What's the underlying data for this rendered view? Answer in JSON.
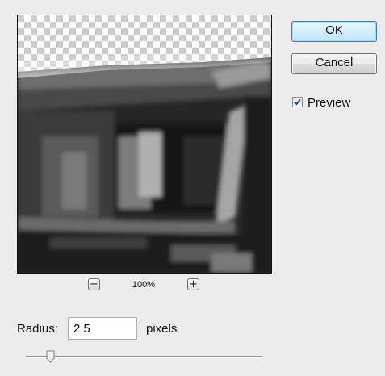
{
  "dialog": {
    "buttons": {
      "ok_label": "OK",
      "cancel_label": "Cancel"
    },
    "preview_toggle": {
      "label": "Preview",
      "checked": true
    },
    "zoom": {
      "level": "100%",
      "zoom_out_symbol": "−",
      "zoom_in_symbol": "+"
    },
    "radius": {
      "label": "Radius:",
      "value": "2.5",
      "units": "pixels",
      "min": 0.1,
      "max": 250
    },
    "colors": {
      "ok_border": "#3c7fb1",
      "checkbox_check": "#1e4d8c",
      "dialog_bg": "#ececec"
    }
  }
}
